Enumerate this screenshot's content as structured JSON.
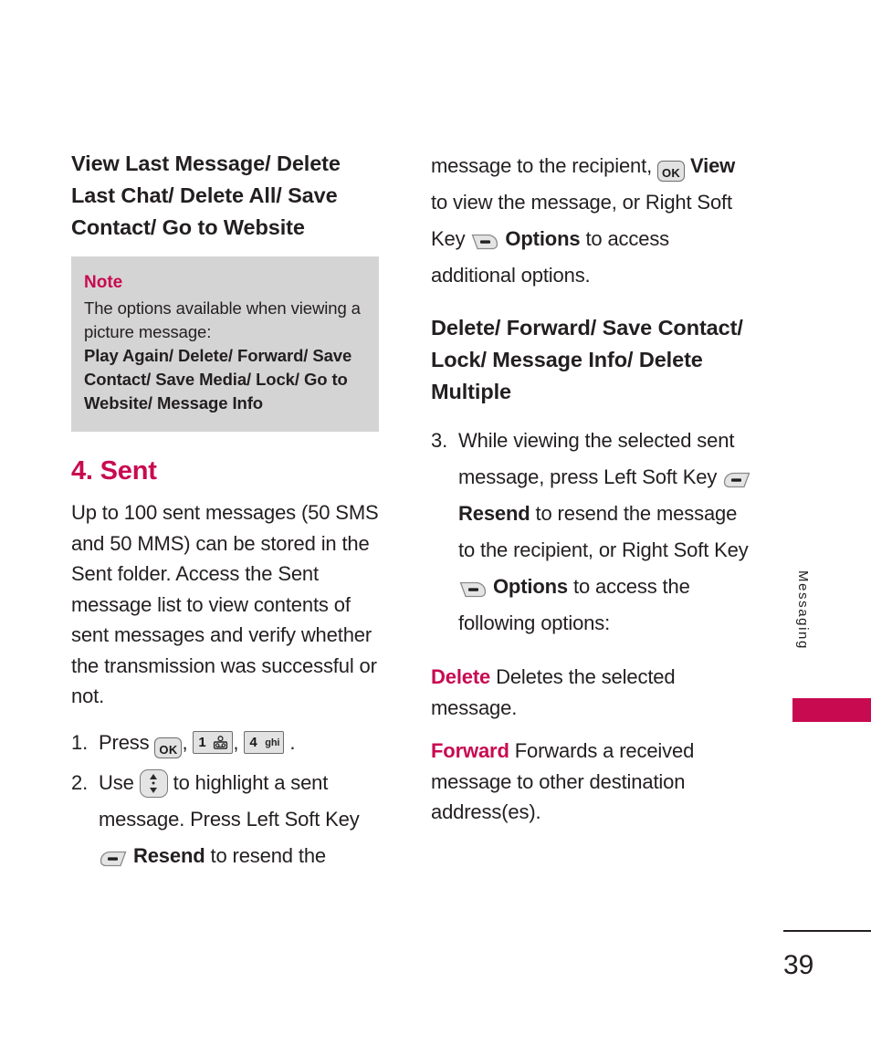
{
  "page": {
    "number": "39",
    "side_tab_label": "Messaging",
    "accent_color": "#c80a50",
    "text_color": "#231f20",
    "note_background": "#d5d4d4"
  },
  "left_column": {
    "heading": "View Last Message/ Delete Last Chat/ Delete All/ Save Contact/ Go to Website",
    "note": {
      "title": "Note",
      "text": "The options available when viewing a picture message:",
      "options": "Play Again/ Delete/ Forward/ Save Contact/ Save Media/ Lock/ Go to Website/ Message Info"
    },
    "chapter_heading": "4. Sent",
    "body": "Up to 100 sent messages (50 SMS and 50 MMS) can be stored in the Sent folder. Access the Sent message list to view contents of sent messages and verify whether the transmission was successful or not.",
    "steps": [
      {
        "number": "1.",
        "lead": "Press",
        "keys": [
          {
            "icon": "ok-key-icon",
            "label": "OK"
          },
          {
            "icon": "number-key-1-icon",
            "digit": "1",
            "sub": "voicemail"
          },
          {
            "icon": "number-key-4-icon",
            "digit": "4",
            "sub": "ghi"
          }
        ],
        "trailing": "."
      },
      {
        "number": "2.",
        "lead": "Use",
        "nav_icon": "up-down-navigation-key-icon",
        "after_nav": "to highlight a sent message. Press Left Soft Key",
        "soft_key_icon": "left-soft-key-icon",
        "soft_key_label": "Resend",
        "tail": "to resend the"
      }
    ]
  },
  "right_column": {
    "continuation": {
      "part1": "message to the recipient,",
      "ok_key_icon": "ok-key-icon",
      "ok_key_label": "OK",
      "view_label": "View",
      "part2": "to view the message, or Right Soft Key",
      "right_soft_key_icon": "right-soft-key-icon",
      "options_label": "Options",
      "part3": "to access additional options."
    },
    "heading": "Delete/ Forward/ Save Contact/ Lock/ Message Info/ Delete Multiple",
    "step3": {
      "number": "3.",
      "part1": "While viewing the selected sent message, press Left Soft Key",
      "left_soft_key_icon": "left-soft-key-icon",
      "resend_label": "Resend",
      "part2": "to resend the message to the recipient, or Right Soft Key",
      "right_soft_key_icon": "right-soft-key-icon",
      "options_label": "Options",
      "part3": "to access the following options:"
    },
    "definitions": [
      {
        "term": "Delete",
        "text": "Deletes the selected message."
      },
      {
        "term": "Forward",
        "text": "Forwards a received message to other destination address(es)."
      }
    ]
  }
}
